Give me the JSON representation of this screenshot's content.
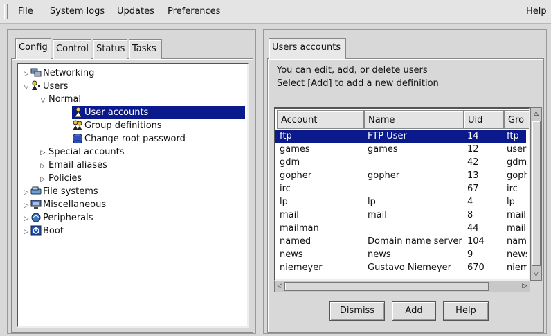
{
  "menubar": {
    "items": [
      "File",
      "System logs",
      "Updates",
      "Preferences"
    ],
    "help": "Help"
  },
  "left_tabs": [
    "Config",
    "Control",
    "Status",
    "Tasks"
  ],
  "tree": [
    {
      "label": "Networking",
      "icon": "network-icon",
      "expander": "collapsed"
    },
    {
      "label": "Users",
      "icon": "users-icon",
      "expander": "expanded"
    },
    {
      "label": "Normal",
      "icon": "",
      "expander": "expanded"
    },
    {
      "label": "User accounts",
      "icon": "user-icon",
      "expander": "none",
      "selected": true
    },
    {
      "label": "Group definitions",
      "icon": "group-icon",
      "expander": "none"
    },
    {
      "label": "Change root password",
      "icon": "password-icon",
      "expander": "none"
    },
    {
      "label": "Special accounts",
      "icon": "",
      "expander": "collapsed"
    },
    {
      "label": "Email aliases",
      "icon": "",
      "expander": "collapsed"
    },
    {
      "label": "Policies",
      "icon": "",
      "expander": "collapsed"
    },
    {
      "label": "File systems",
      "icon": "filesystem-icon",
      "expander": "collapsed"
    },
    {
      "label": "Miscellaneous",
      "icon": "misc-icon",
      "expander": "collapsed"
    },
    {
      "label": "Peripherals",
      "icon": "peripherals-icon",
      "expander": "collapsed"
    },
    {
      "label": "Boot",
      "icon": "boot-icon",
      "expander": "collapsed"
    }
  ],
  "right_tab": "Users accounts",
  "description": {
    "line1": "You can edit, add, or delete users",
    "line2": "Select [Add] to add a new definition"
  },
  "table": {
    "columns": [
      "Account",
      "Name",
      "Uid",
      "Gro"
    ],
    "rows": [
      {
        "account": "ftp",
        "name": "FTP User",
        "uid": "14",
        "group": "ftp",
        "selected": true
      },
      {
        "account": "games",
        "name": "games",
        "uid": "12",
        "group": "users"
      },
      {
        "account": "gdm",
        "name": "",
        "uid": "42",
        "group": "gdm"
      },
      {
        "account": "gopher",
        "name": "gopher",
        "uid": "13",
        "group": "gopher"
      },
      {
        "account": "irc",
        "name": "",
        "uid": "67",
        "group": "irc"
      },
      {
        "account": "lp",
        "name": "lp",
        "uid": "4",
        "group": "lp"
      },
      {
        "account": "mail",
        "name": "mail",
        "uid": "8",
        "group": "mail"
      },
      {
        "account": "mailman",
        "name": "",
        "uid": "44",
        "group": "mailman"
      },
      {
        "account": "named",
        "name": "Domain name server",
        "uid": "104",
        "group": "named"
      },
      {
        "account": "news",
        "name": "news",
        "uid": "9",
        "group": "news"
      },
      {
        "account": "niemeyer",
        "name": "Gustavo Niemeyer",
        "uid": "670",
        "group": "niemeyer"
      }
    ]
  },
  "buttons": {
    "dismiss": "Dismiss",
    "add": "Add",
    "help": "Help"
  },
  "colors": {
    "selection": "#0a1a8c",
    "background": "#d8d8d8"
  }
}
